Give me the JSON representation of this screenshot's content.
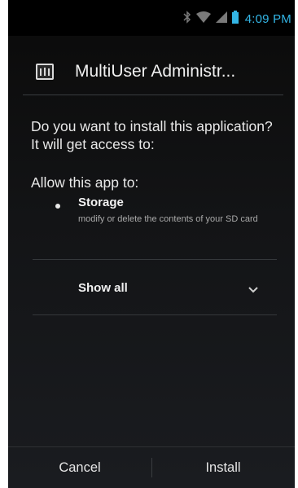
{
  "status_bar": {
    "time": "4:09 PM",
    "icons": [
      "bluetooth-icon",
      "wifi-icon",
      "signal-icon",
      "battery-icon"
    ],
    "accent": "#33b5e5"
  },
  "dialog": {
    "app_icon": "app-icon",
    "app_title": "MultiUser Administr...",
    "question": "Do you want to install this application? It will get access to:",
    "allow_label": "Allow this app to:",
    "permissions": [
      {
        "title": "Storage",
        "description": "modify or delete the contents of your SD card"
      }
    ],
    "show_all_label": "Show all",
    "show_all_icon": "chevron-down-icon"
  },
  "buttons": {
    "cancel": "Cancel",
    "install": "Install"
  }
}
